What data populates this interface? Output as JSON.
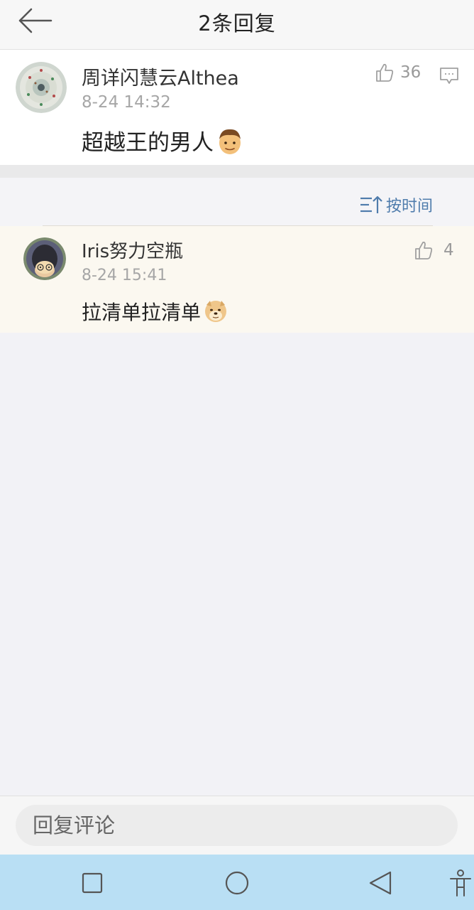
{
  "header": {
    "title": "2条回复",
    "back_icon": "arrow-left-icon"
  },
  "main_comment": {
    "username": "周详闪慧云Althea",
    "timestamp": "8-24 14:32",
    "text": "超越王的男人",
    "emoji": "man-emoji",
    "like_count": "36",
    "like_icon": "thumbs-up-icon",
    "reply_icon": "comment-bubble-icon"
  },
  "sort": {
    "label": "按时间",
    "icon": "sort-time-icon"
  },
  "replies": [
    {
      "username": "Iris努力空瓶",
      "timestamp": "8-24 15:41",
      "text": "拉清单拉清单",
      "emoji": "doge-emoji",
      "like_count": "4",
      "like_icon": "thumbs-up-icon"
    }
  ],
  "bottom_bar": {
    "input_placeholder": "回复评论"
  },
  "nav": {
    "recents_icon": "square-icon",
    "home_icon": "circle-icon",
    "back_icon": "triangle-back-icon",
    "accessibility_icon": "accessibility-icon"
  },
  "colors": {
    "accent_blue": "#4f7cac",
    "nav_bar": "#b9dff4",
    "reply_highlight": "#fbf8f0"
  }
}
